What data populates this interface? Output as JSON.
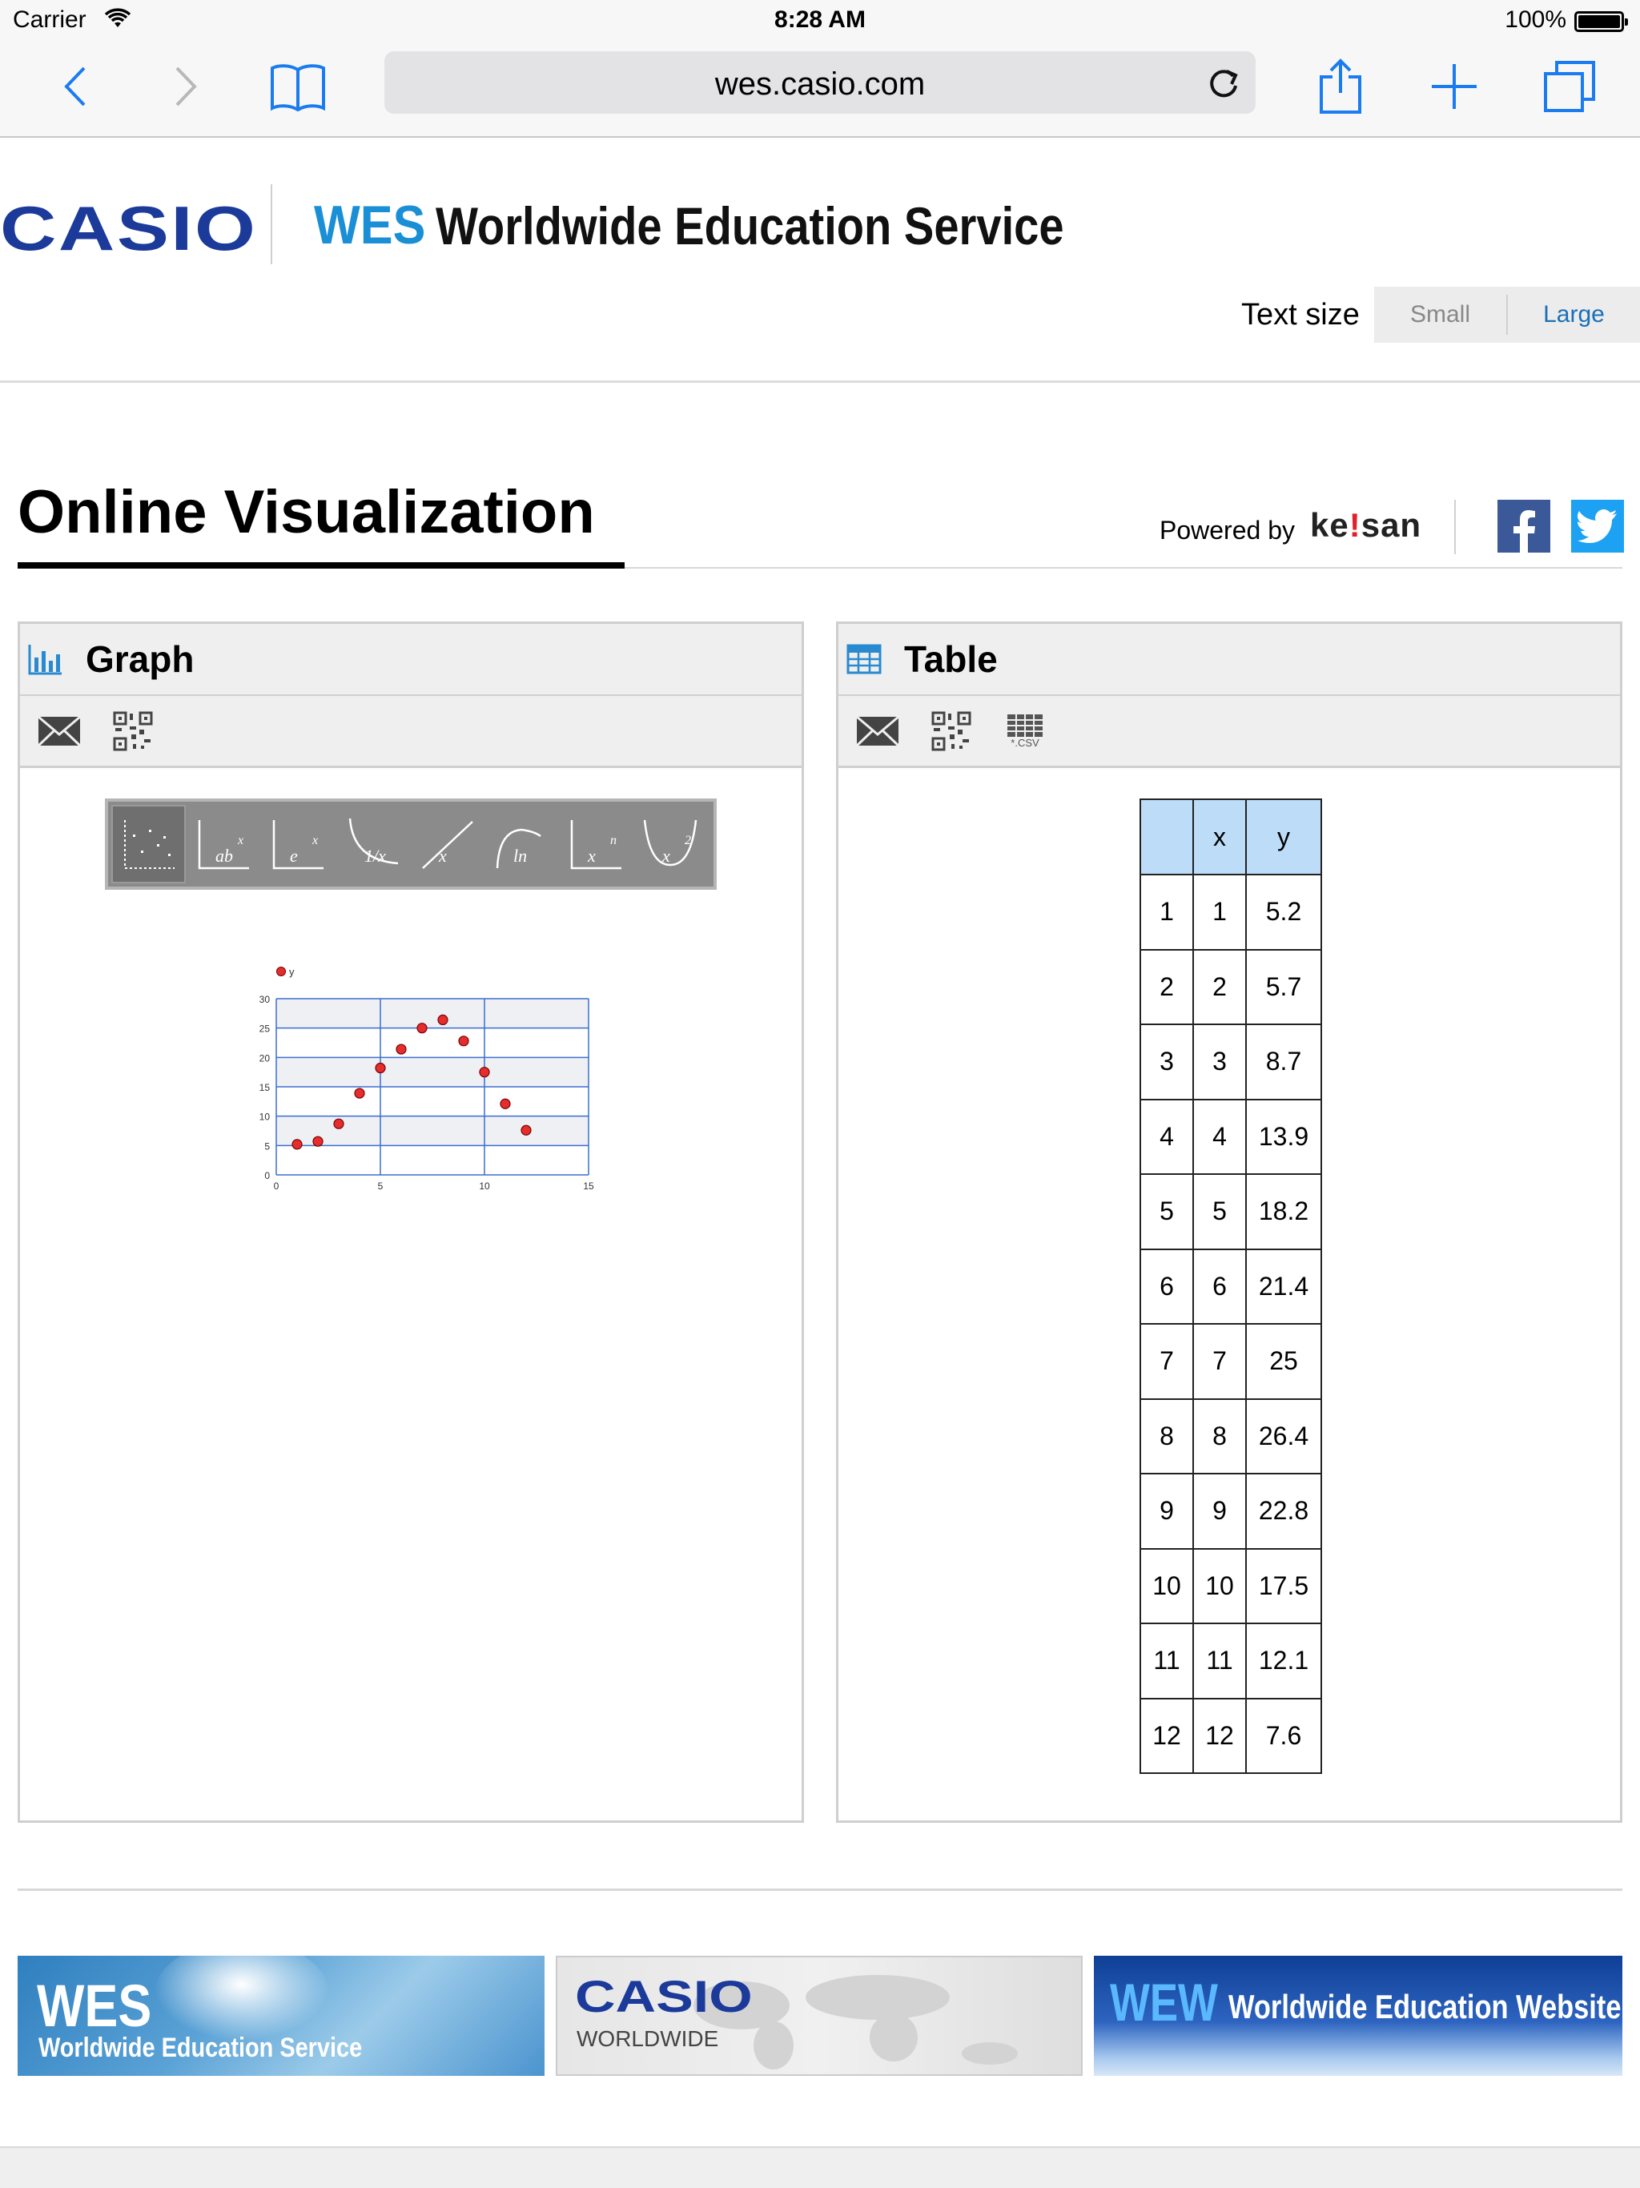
{
  "status_bar": {
    "carrier": "Carrier",
    "time": "8:28 AM",
    "battery": "100%"
  },
  "browser": {
    "url": "wes.casio.com"
  },
  "header": {
    "casio_logo": "CASIO",
    "wes_logo": "WES",
    "site_name": "Worldwide Education Service",
    "text_size_label": "Text size",
    "text_size_small": "Small",
    "text_size_large": "Large"
  },
  "title": {
    "page_title": "Online Visualization",
    "powered_by": "Powered by",
    "keisan_pre": "ke",
    "keisan_dot": "!",
    "keisan_post": "san"
  },
  "graph_panel": {
    "title": "Graph"
  },
  "table_panel": {
    "title": "Table",
    "csv_label": "*.CSV"
  },
  "regression_buttons": [
    "scatter-icon",
    "ab-x-icon",
    "e-x-icon",
    "1/x-icon",
    "linear-icon",
    "ln-icon",
    "x-n-icon",
    "x2-icon"
  ],
  "chart_data": {
    "type": "scatter",
    "legend": "y",
    "x": [
      1,
      2,
      3,
      4,
      5,
      6,
      7,
      8,
      9,
      10,
      11,
      12
    ],
    "series": [
      {
        "name": "y",
        "values": [
          5.2,
          5.7,
          8.7,
          13.9,
          18.2,
          21.4,
          25,
          26.4,
          22.8,
          17.5,
          12.1,
          7.6
        ]
      }
    ],
    "xlim": [
      0,
      15
    ],
    "ylim": [
      0,
      30
    ],
    "xticks": [
      "0",
      "5",
      "10",
      "15"
    ],
    "yticks": [
      "0",
      "5",
      "10",
      "15",
      "20",
      "25",
      "30"
    ],
    "grid": true,
    "point_color": "#e52d2d"
  },
  "table": {
    "headers": [
      "",
      "x",
      "y"
    ],
    "rows": [
      [
        "1",
        "1",
        "5.2"
      ],
      [
        "2",
        "2",
        "5.7"
      ],
      [
        "3",
        "3",
        "8.7"
      ],
      [
        "4",
        "4",
        "13.9"
      ],
      [
        "5",
        "5",
        "18.2"
      ],
      [
        "6",
        "6",
        "21.4"
      ],
      [
        "7",
        "7",
        "25"
      ],
      [
        "8",
        "8",
        "26.4"
      ],
      [
        "9",
        "9",
        "22.8"
      ],
      [
        "10",
        "10",
        "17.5"
      ],
      [
        "11",
        "11",
        "12.1"
      ],
      [
        "12",
        "12",
        "7.6"
      ]
    ]
  },
  "footer": {
    "banner1_big": "WES",
    "banner1_sub": "Worldwide Education Service",
    "banner2_big": "CASIO",
    "banner2_sub": "WORLDWIDE",
    "banner3_big": "WEW",
    "banner3_sub": "Worldwide Education Website"
  },
  "colors": {
    "accent_blue": "#1a6fb8",
    "table_header": "#bcdcf8",
    "casio_blue": "#1b3a9a",
    "wes_blue": "#1a8fd6"
  }
}
